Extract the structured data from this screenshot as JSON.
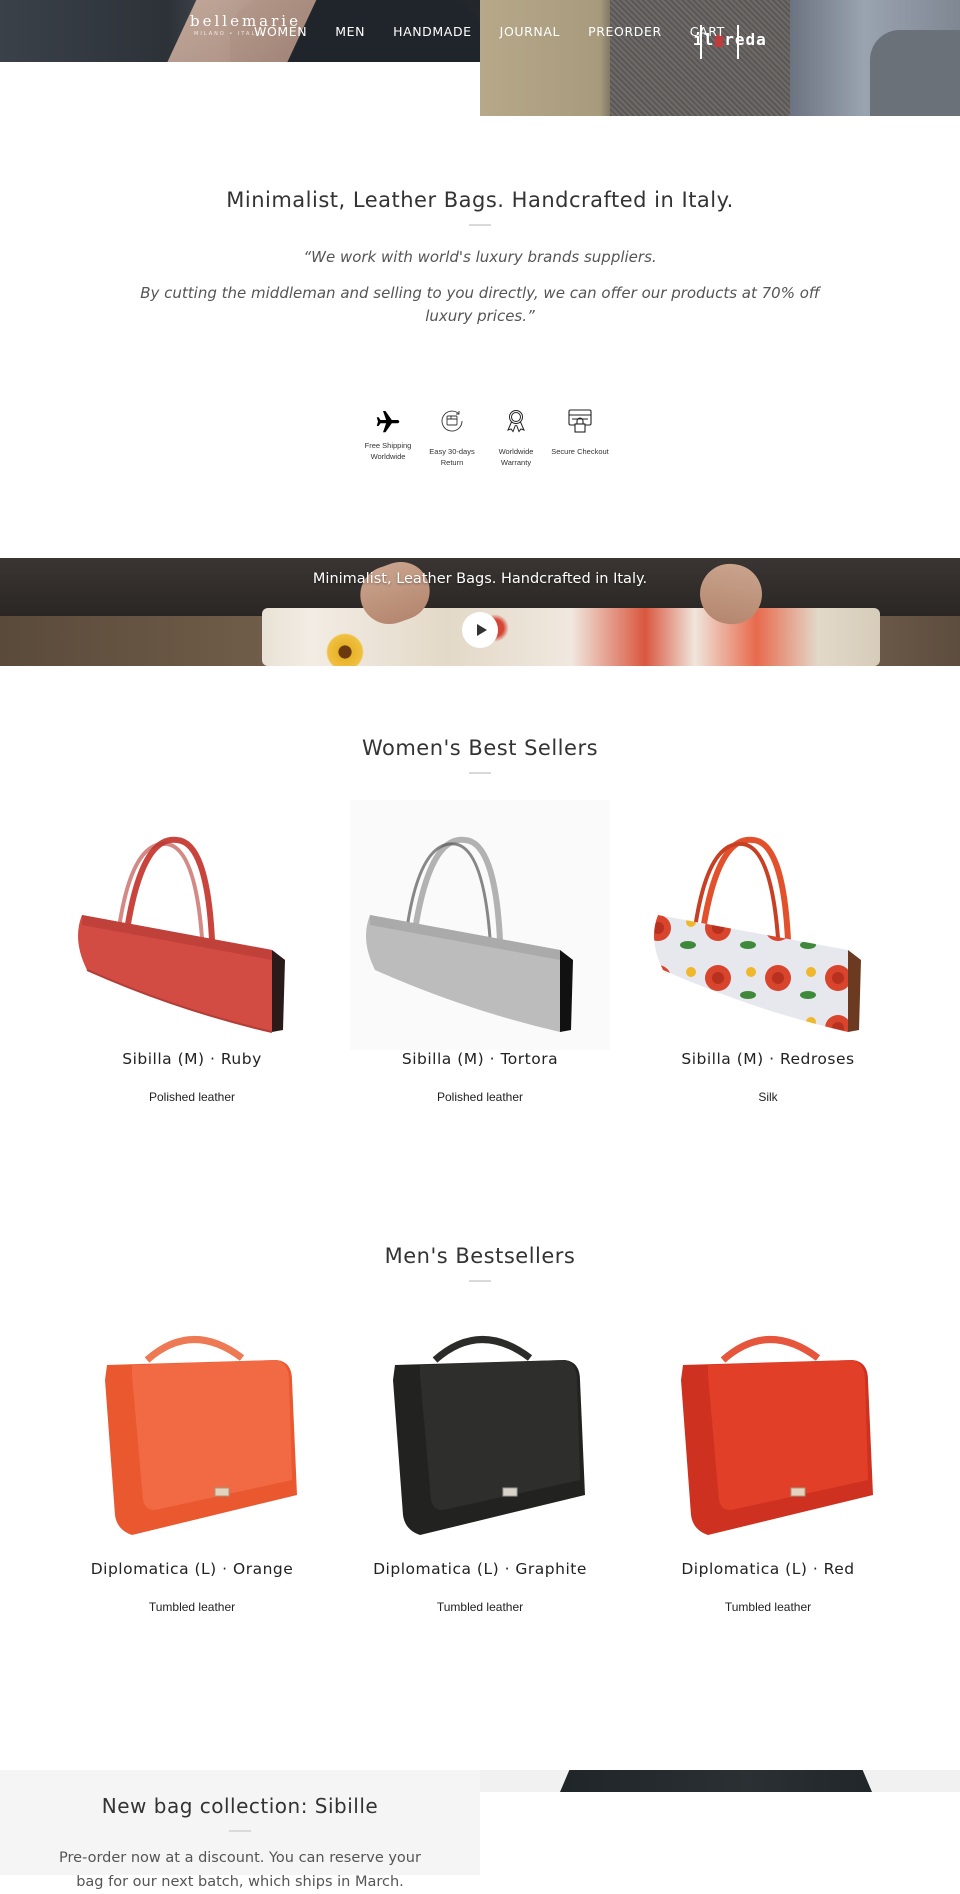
{
  "header": {
    "women_brand": {
      "name": "bellemarie",
      "tagline": "MILANO • ITALIA"
    },
    "men_brand": {
      "name_prefix": "il",
      "name_suffix": "reda"
    },
    "nav": [
      {
        "label": "WOMEN"
      },
      {
        "label": "MEN"
      },
      {
        "label": "HANDMADE"
      },
      {
        "label": "JOURNAL"
      },
      {
        "label": "PREORDER"
      },
      {
        "label": "CART"
      }
    ]
  },
  "intro": {
    "title": "Minimalist, Leather Bags. Handcrafted in Italy.",
    "quote_line1": "“We work with world's luxury brands suppliers.",
    "quote_line2": "By cutting the middleman and selling to you directly, we can offer our products at 70% off luxury prices.”"
  },
  "features": [
    {
      "icon": "airplane-icon",
      "label": "Free Shipping Worldwide"
    },
    {
      "icon": "return-box-icon",
      "label": "Easy 30-days Return"
    },
    {
      "icon": "award-ribbon-icon",
      "label": "Worldwide Warranty"
    },
    {
      "icon": "secure-lock-icon",
      "label": "Secure Checkout"
    }
  ],
  "video": {
    "caption": "Minimalist, Leather Bags. Handcrafted in Italy.",
    "play_icon": "play-icon"
  },
  "womens": {
    "title": "Women's Best Sellers",
    "products": [
      {
        "name": "Sibilla (M) · Ruby",
        "material": "Polished leather",
        "color": "#d24c44"
      },
      {
        "name": "Sibilla (M) · Tortora",
        "material": "Polished leather",
        "color": "#b9b9b9"
      },
      {
        "name": "Sibilla (M) · Redroses",
        "material": "Silk",
        "color": "#e8e8ec"
      }
    ]
  },
  "mens": {
    "title": "Men's Bestsellers",
    "products": [
      {
        "name": "Diplomatica (L) · Orange",
        "material": "Tumbled leather",
        "color": "#f0603c"
      },
      {
        "name": "Diplomatica (L) · Graphite",
        "material": "Tumbled leather",
        "color": "#2a2a28"
      },
      {
        "name": "Diplomatica (L) · Red",
        "material": "Tumbled leather",
        "color": "#e03a26"
      }
    ]
  },
  "promo": {
    "title": "New bag collection: Sibille",
    "text": "Pre-order now at a discount. You can reserve your bag for our next batch, which ships in March."
  }
}
